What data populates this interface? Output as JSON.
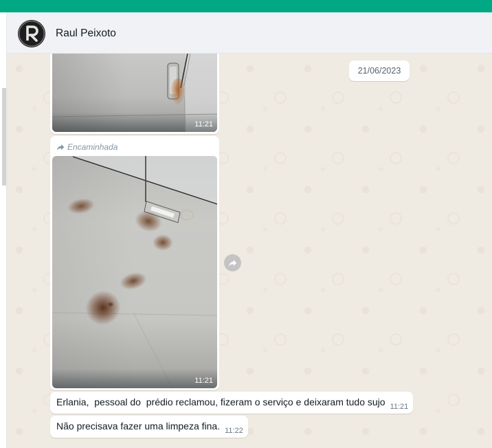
{
  "colors": {
    "top_bar": "#00a884",
    "header_background": "#f0f2f5",
    "chat_background": "#efeae2",
    "bubble_background": "#ffffff",
    "meta_text": "#667781",
    "forwarded_text": "#8696a0"
  },
  "header": {
    "contact_name": "Raul Peixoto",
    "avatar_icon": "profile-logo-avatar"
  },
  "date_badge": {
    "label": "21/06/2023"
  },
  "messages": [
    {
      "time": "11:21",
      "has_image": true
    },
    {
      "forwarded_label": "Encaminhada",
      "forwarded_icon": "forwarded-arrow-icon",
      "time": "11:21",
      "has_image": true
    },
    {
      "text": "Erlania,  pessoal do  prédio reclamou, fizeram o serviço e deixaram tudo sujo",
      "time": "11:21"
    },
    {
      "text": "Não precisava fazer uma limpeza fina.",
      "time": "11:22"
    }
  ],
  "forward_button": {
    "icon": "forward-icon"
  }
}
